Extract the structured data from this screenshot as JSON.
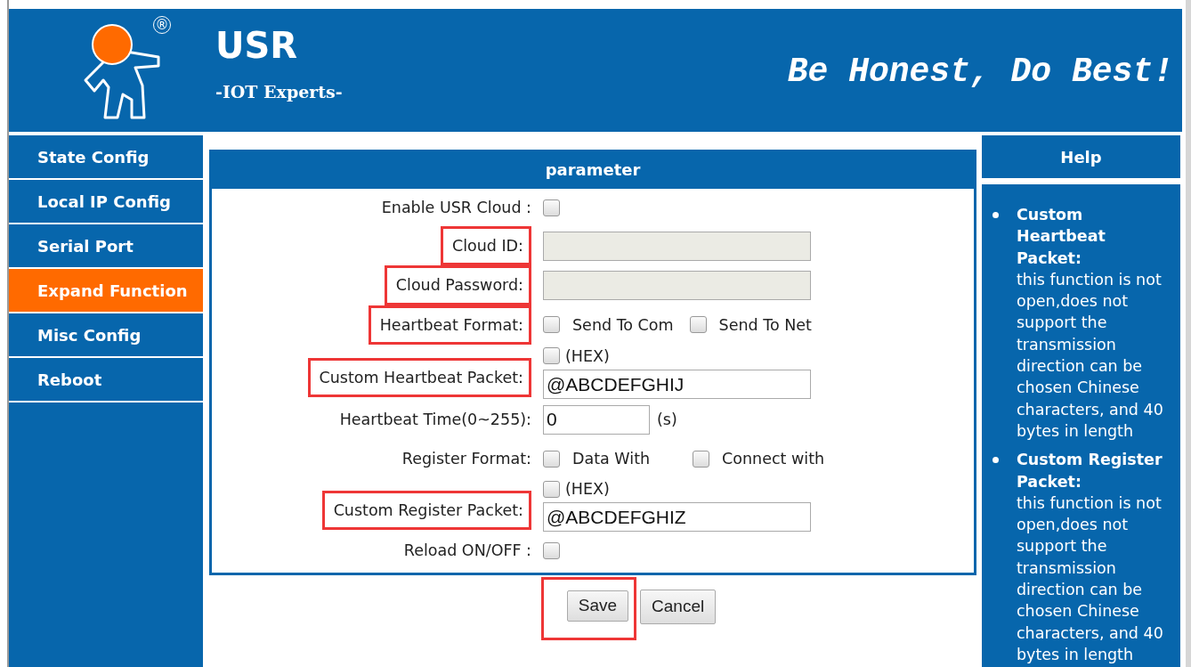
{
  "header": {
    "brand": "USR",
    "registered_mark": "®",
    "tagline": "-IOT Experts-",
    "slogan": "Be Honest, Do Best!"
  },
  "sidebar": {
    "items": [
      {
        "label": "State Config",
        "selected": false
      },
      {
        "label": "Local IP Config",
        "selected": false
      },
      {
        "label": "Serial Port",
        "selected": false
      },
      {
        "label": "Expand Function",
        "selected": true
      },
      {
        "label": "Misc Config",
        "selected": false
      },
      {
        "label": "Reboot",
        "selected": false
      }
    ]
  },
  "panel": {
    "title": "parameter",
    "rows": [
      {
        "kind": "checkbox",
        "label": "Enable USR Cloud :",
        "checked": false,
        "highlighted": false
      },
      {
        "kind": "text",
        "label": "Cloud ID:",
        "value": "",
        "disabled": true,
        "highlighted": true
      },
      {
        "kind": "text",
        "label": "Cloud Password:",
        "value": "",
        "disabled": true,
        "highlighted": true
      },
      {
        "kind": "options",
        "label": "Heartbeat Format:",
        "highlighted": true,
        "options": [
          {
            "label": "Send To Com",
            "checked": false
          },
          {
            "label": "Send To Net",
            "checked": false
          }
        ]
      },
      {
        "kind": "packet",
        "label": "Custom Heartbeat Packet:",
        "hex_label": "(HEX)",
        "hex_checked": false,
        "value": "@ABCDEFGHIJ",
        "highlighted": true
      },
      {
        "kind": "number",
        "label": "Heartbeat Time(0~255):",
        "value": "0",
        "unit": "(s)",
        "highlighted": false
      },
      {
        "kind": "options",
        "label": "Register Format:",
        "highlighted": false,
        "options": [
          {
            "label": "Data With",
            "checked": false
          },
          {
            "label": "Connect with",
            "checked": false
          }
        ]
      },
      {
        "kind": "packet",
        "label": "Custom Register Packet:",
        "hex_label": "(HEX)",
        "hex_checked": false,
        "value": "@ABCDEFGHIZ",
        "highlighted": true
      },
      {
        "kind": "checkbox",
        "label": "Reload ON/OFF :",
        "checked": false,
        "highlighted": false
      }
    ]
  },
  "buttons": [
    {
      "label": "Save",
      "highlighted": true
    },
    {
      "label": "Cancel",
      "highlighted": false
    }
  ],
  "help": {
    "title": "Help",
    "entries": [
      {
        "term": "Custom Heartbeat Packet:",
        "text": "this function is not open,does not support the transmission direction can be chosen Chinese characters, and 40 bytes in length"
      },
      {
        "term": "Custom Register Packet:",
        "text": "this function is not open,does not support the transmission direction can be chosen Chinese characters, and 40 bytes in length"
      }
    ]
  }
}
